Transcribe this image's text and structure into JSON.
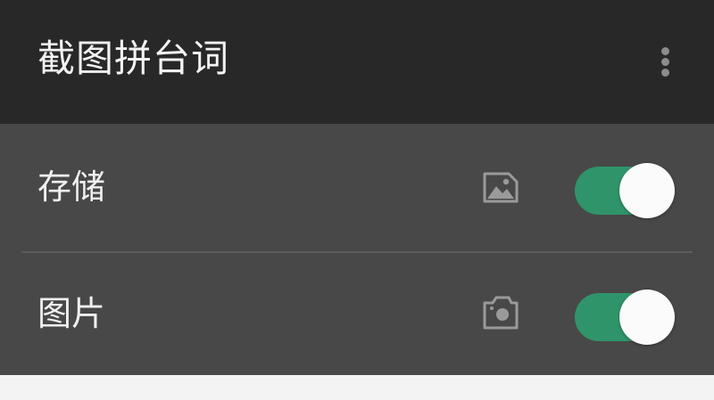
{
  "app_bar": {
    "title": "截图拼台词",
    "menu_icon": "more-vert-icon"
  },
  "permissions": [
    {
      "label": "存储",
      "icon": "image-icon",
      "enabled": true
    },
    {
      "label": "图片",
      "icon": "camera-icon",
      "enabled": true
    }
  ],
  "colors": {
    "app_bar_bg": "#282828",
    "list_bg": "#484848",
    "toggle_on": "#2f946a",
    "thumb": "#fbfbfb"
  }
}
